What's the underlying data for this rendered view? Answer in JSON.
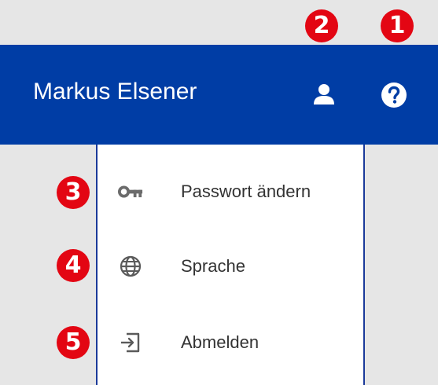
{
  "header": {
    "user_name": "Markus Elsener",
    "user_icon": "person-icon",
    "help_icon": "help-circle-icon",
    "background_color": "#003da5"
  },
  "menu": {
    "items": [
      {
        "label": "Passwort ändern",
        "icon": "key-icon"
      },
      {
        "label": "Sprache",
        "icon": "globe-icon"
      },
      {
        "label": "Abmelden",
        "icon": "logout-icon"
      }
    ]
  },
  "callouts": {
    "color": "#e30613",
    "markers": [
      "1",
      "2",
      "3",
      "4",
      "5"
    ]
  }
}
